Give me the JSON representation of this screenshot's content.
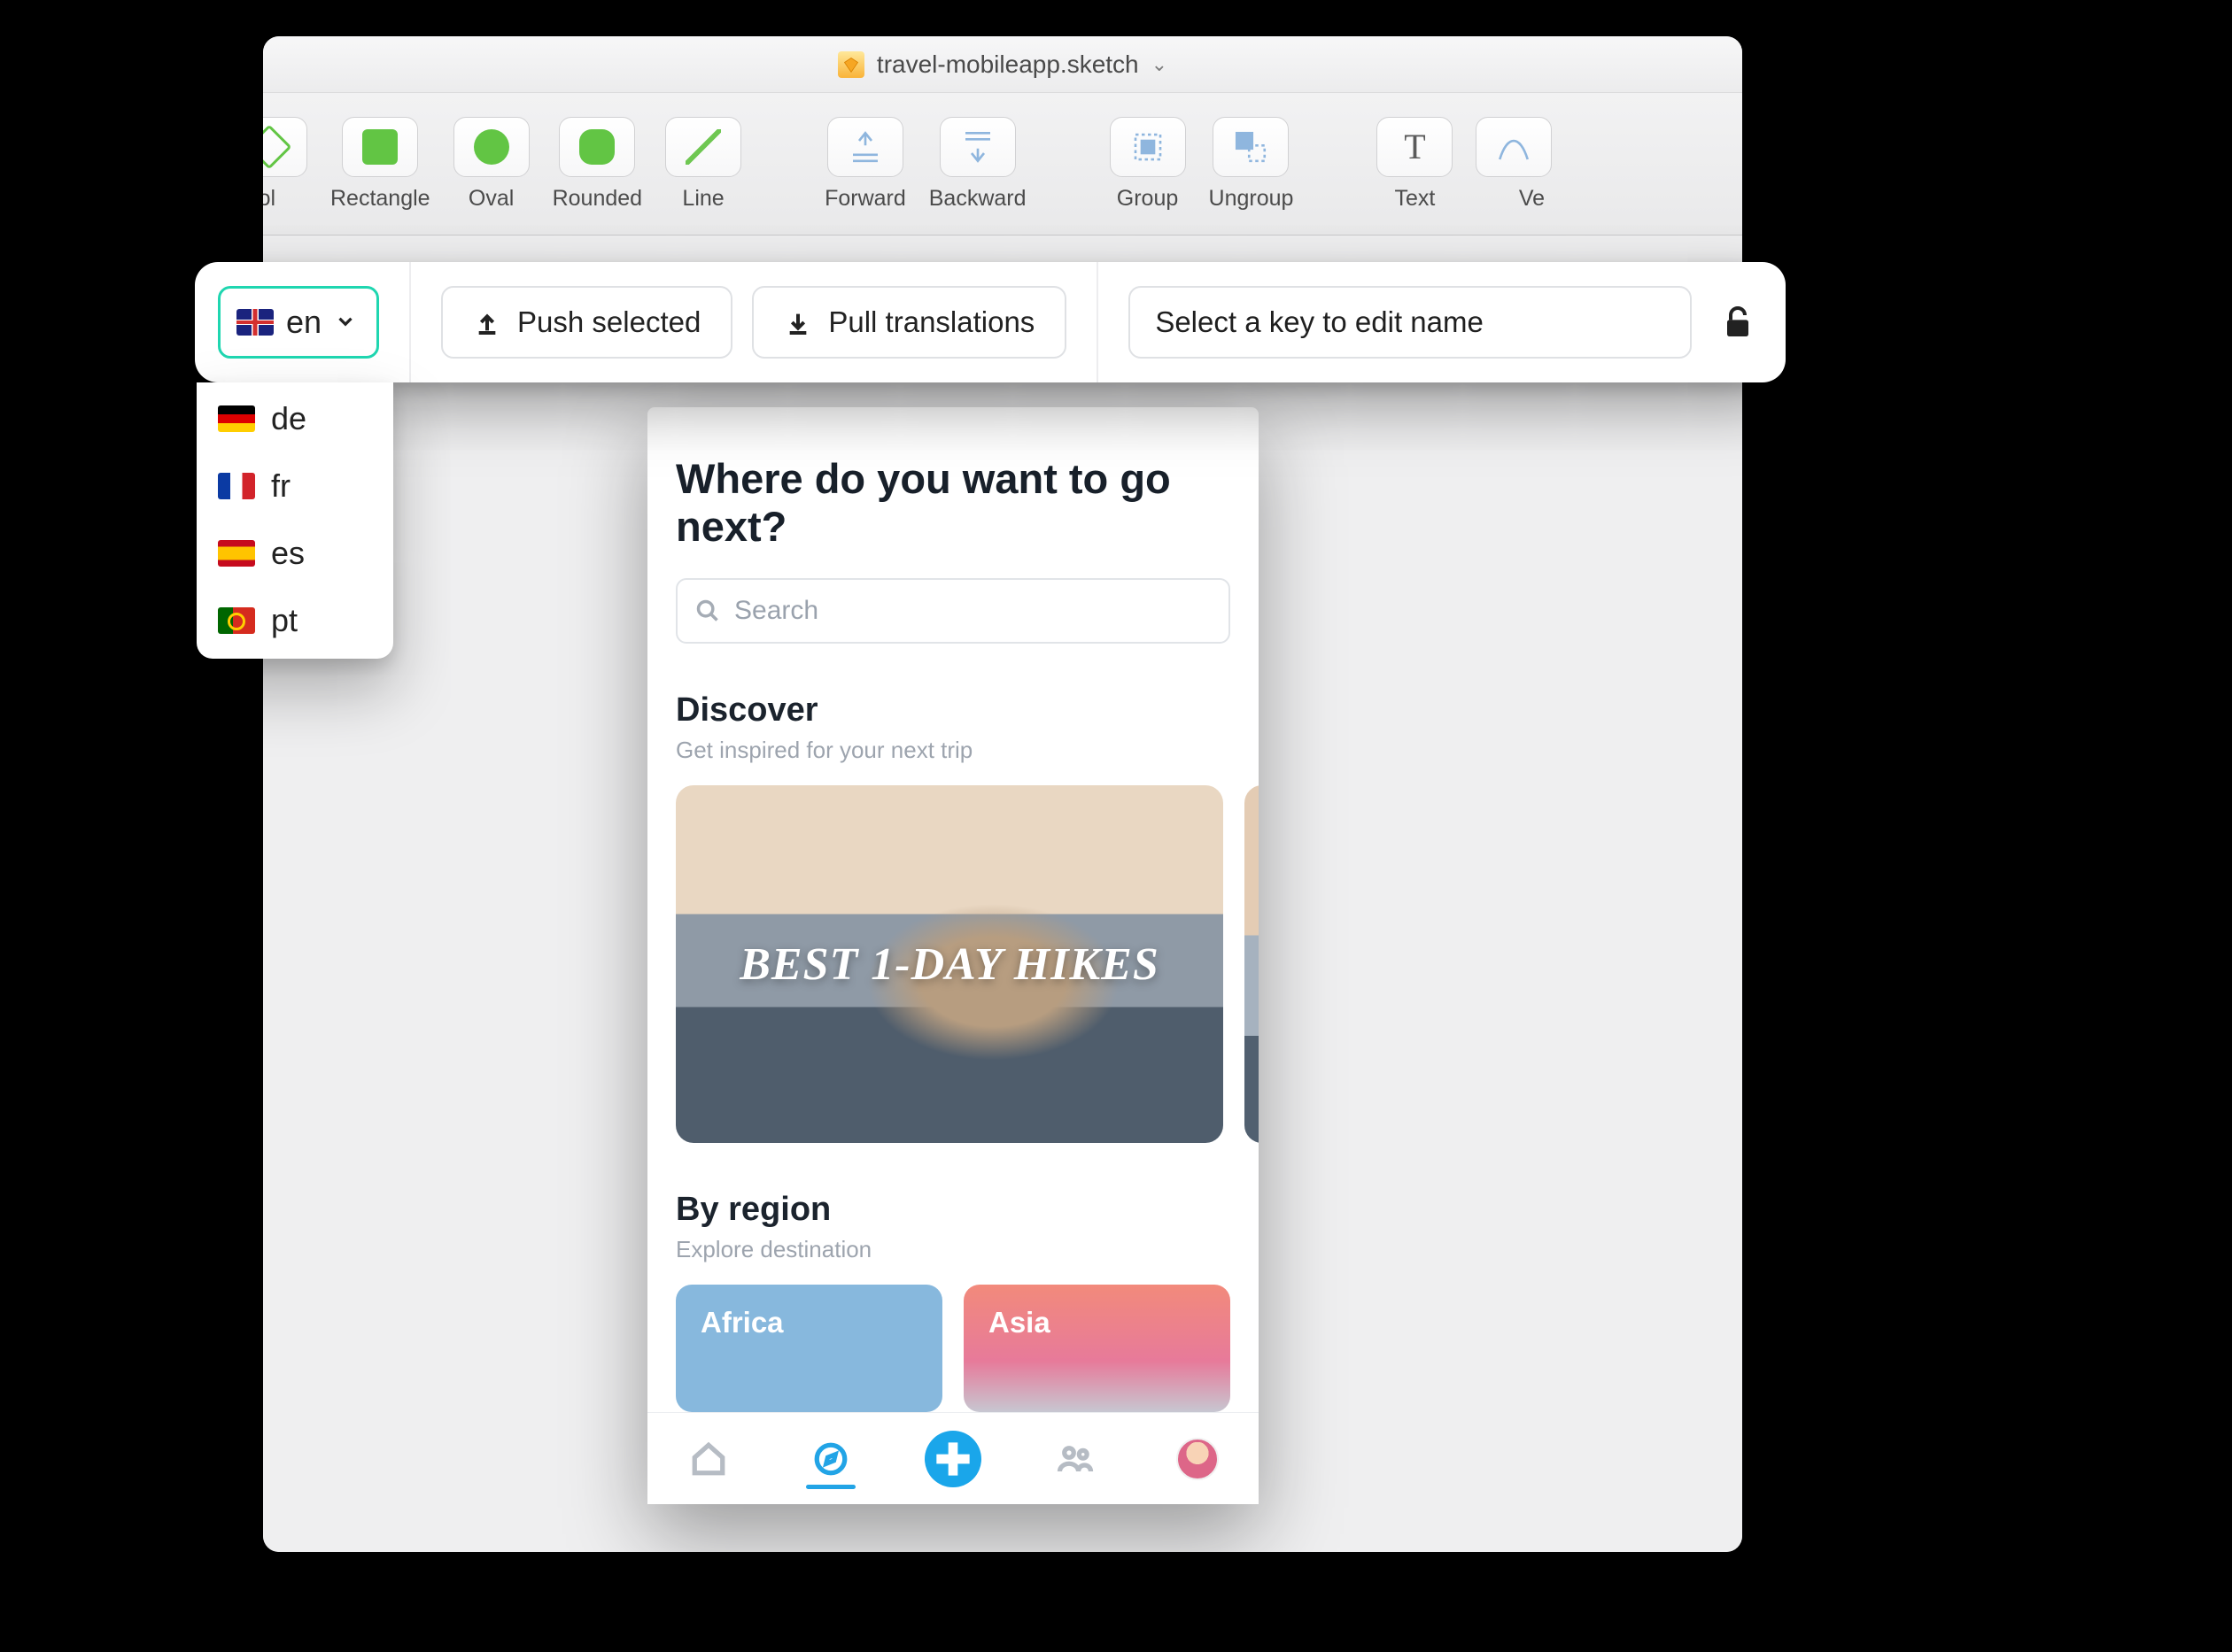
{
  "window": {
    "title": "travel-mobileapp.sketch"
  },
  "toolbar": {
    "items": [
      {
        "label": "mbol"
      },
      {
        "label": "Rectangle"
      },
      {
        "label": "Oval"
      },
      {
        "label": "Rounded"
      },
      {
        "label": "Line"
      },
      {
        "label": "Forward"
      },
      {
        "label": "Backward"
      },
      {
        "label": "Group"
      },
      {
        "label": "Ungroup"
      },
      {
        "label": "Text"
      },
      {
        "label": "Ve"
      }
    ]
  },
  "plugin": {
    "current_lang": "en",
    "push_label": "Push selected",
    "pull_label": "Pull translations",
    "key_placeholder": "Select a key to edit name",
    "lang_options": [
      {
        "code": "de"
      },
      {
        "code": "fr"
      },
      {
        "code": "es"
      },
      {
        "code": "pt"
      }
    ]
  },
  "mock": {
    "headline": "Where do you want to go next?",
    "search_placeholder": "Search",
    "discover_title": "Discover",
    "discover_sub": "Get inspired for your next trip",
    "card1_text": "BEST 1-DAY HIKES",
    "region_title": "By region",
    "region_sub": "Explore destination",
    "region1": "Africa",
    "region2": "Asia"
  }
}
